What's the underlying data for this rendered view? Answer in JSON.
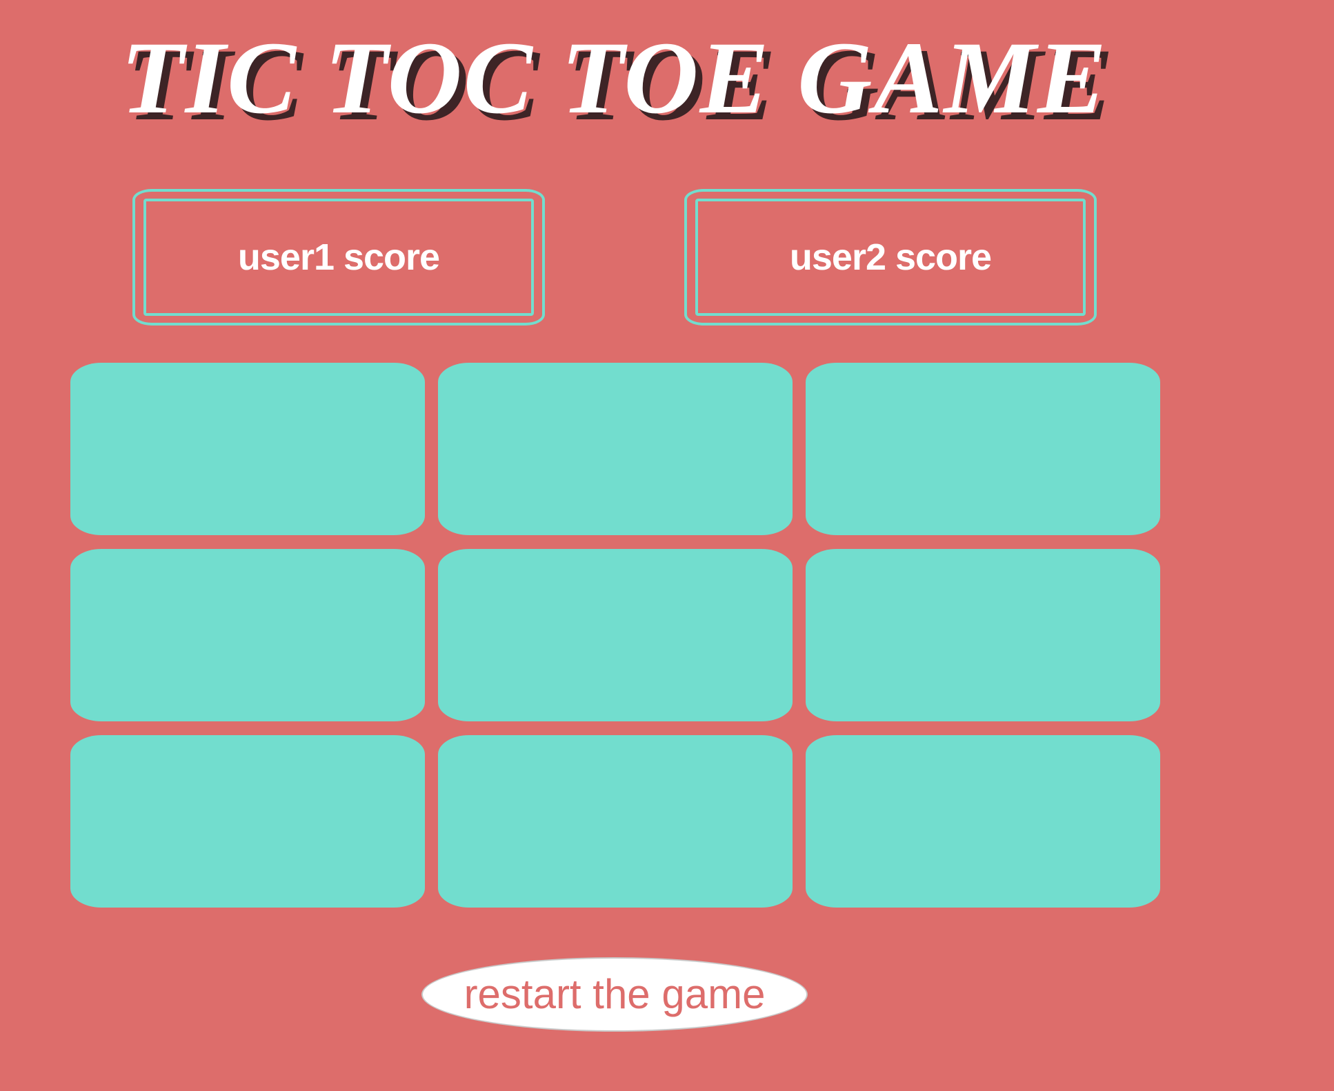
{
  "title": "TIC TOC TOE GAME",
  "scores": {
    "user1_label": "user1 score",
    "user2_label": "user2 score"
  },
  "board": {
    "cells": [
      "",
      "",
      "",
      "",
      "",
      "",
      "",
      "",
      ""
    ]
  },
  "restart_label": "restart the game",
  "colors": {
    "background": "#dd6d6b",
    "cell": "#72ddce",
    "title": "#ffffff",
    "title_shadow": "#3d2426",
    "button_bg": "#ffffff",
    "button_text": "#dd6d6b"
  }
}
